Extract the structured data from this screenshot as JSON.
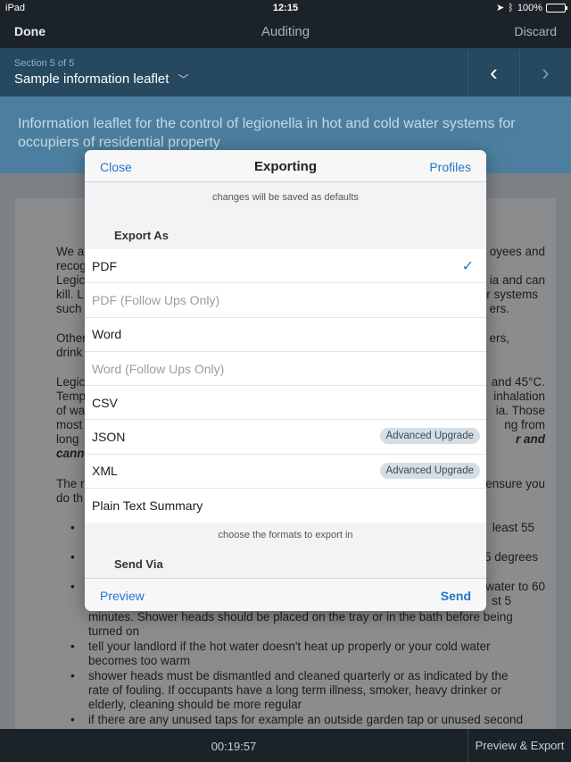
{
  "status_bar": {
    "device": "iPad",
    "time": "12:15",
    "battery": "100%"
  },
  "nav": {
    "done": "Done",
    "title": "Auditing",
    "discard": "Discard"
  },
  "section": {
    "counter": "Section 5 of 5",
    "name": "Sample information leaflet"
  },
  "heading": "Information leaflet for the control of legionella in hot and cold water systems for occupiers of residential property",
  "document": {
    "fragments": [
      "We a",
      "oyees and",
      "recog",
      "Legic",
      "ia and can",
      "kill. L",
      "r systems",
      "such",
      "ers.",
      "Other",
      "ers,",
      "drink",
      "Legic",
      "and 45°C.",
      "Temp",
      "inhalation",
      "of wa",
      "ia.  Those",
      "most",
      "ng from",
      "long",
      "r and",
      "cann",
      "The r",
      "ensure you",
      "do th",
      "least 55",
      "5 degrees",
      "water to 60",
      "st 5"
    ],
    "lines": [
      "minutes. Shower heads should be placed on the tray or in the bath before being",
      "turned on",
      "tell your landlord if the hot water doesn't heat up properly or your cold water",
      "becomes too warm",
      "shower heads must be dismantled and cleaned quarterly or as indicated by the",
      "rate of fouling. If occupants have a long term illness, smoker, heavy drinker or",
      "elderly, cleaning should be more regular",
      "if there are any unused taps for example an outside garden tap or unused second"
    ]
  },
  "bottom_bar": {
    "timer": "00:19:57",
    "export": "Preview & Export"
  },
  "modal": {
    "close": "Close",
    "title": "Exporting",
    "profiles": "Profiles",
    "hint_top": "changes will be saved as defaults",
    "export_as": "Export As",
    "formats": [
      {
        "label": "PDF",
        "selected": true,
        "enabled": true,
        "badge": ""
      },
      {
        "label": "PDF (Follow Ups Only)",
        "selected": false,
        "enabled": false,
        "badge": ""
      },
      {
        "label": "Word",
        "selected": false,
        "enabled": true,
        "badge": ""
      },
      {
        "label": "Word (Follow Ups Only)",
        "selected": false,
        "enabled": false,
        "badge": ""
      },
      {
        "label": "CSV",
        "selected": false,
        "enabled": true,
        "badge": ""
      },
      {
        "label": "JSON",
        "selected": false,
        "enabled": true,
        "badge": "Advanced Upgrade"
      },
      {
        "label": "XML",
        "selected": false,
        "enabled": true,
        "badge": "Advanced Upgrade"
      },
      {
        "label": "Plain Text Summary",
        "selected": false,
        "enabled": true,
        "badge": ""
      }
    ],
    "hint_bottom": "choose the formats to export in",
    "send_via": "Send Via",
    "preview": "Preview",
    "send": "Send"
  },
  "colors": {
    "accent": "#1e78c8",
    "nav_bg": "#1b2329",
    "section_bg": "#27495f",
    "heading_bg": "#4c7f9f"
  }
}
